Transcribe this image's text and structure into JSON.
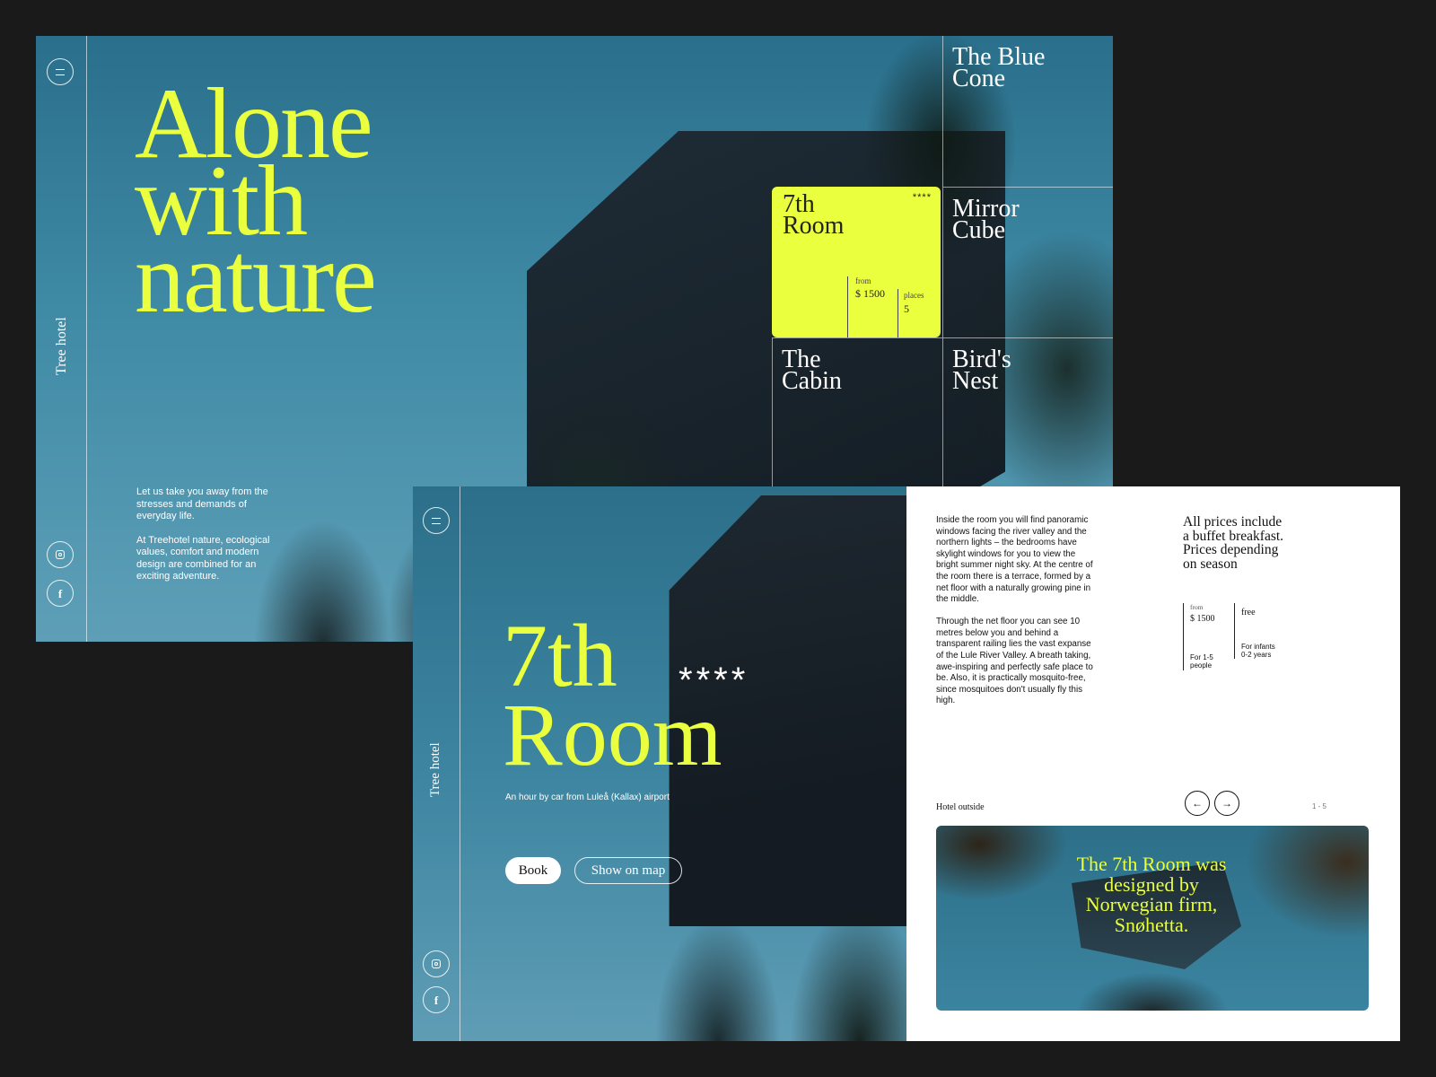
{
  "screen1": {
    "brand": "Tree hotel",
    "hero_title": "Alone\nwith\nnature",
    "intro_p1": "Let us take you away from the stresses and demands of everyday life.",
    "intro_p2": "At Treehotel nature, ecological values, comfort and modern design are combined for an exciting adventure.",
    "rooms": [
      {
        "name": "The Blue\nCone"
      },
      {
        "name": "7th\nRoom",
        "stars": "****",
        "price_label": "from",
        "price": "$ 1500",
        "places_label": "places",
        "places": "5"
      },
      {
        "name": "Mirror\nCube"
      },
      {
        "name": "The\nCabin"
      },
      {
        "name": "Bird's\nNest"
      }
    ]
  },
  "screen2": {
    "brand": "Tree hotel",
    "title": "7th\nRoom",
    "stars": "****",
    "subtitle": "An hour by car from Luleå (Kallax) airport",
    "book_label": "Book",
    "map_label": "Show on map",
    "description_p1": "Inside the room you will find panoramic windows facing the river valley and the northern lights – the bedrooms have skylight windows for you to view the bright summer night sky. At the centre of the room there is a terrace, formed by a net floor with a naturally growing pine in the middle.",
    "description_p2": "Through the net floor you can see 10 metres below you and behind a transparent railing lies the vast expanse of the Lule River Valley. A breath taking, awe-inspiring and perfectly safe place to be. Also, it is practically mosquito-free, since mosquitoes don't usually fly this high.",
    "prices_note": "All prices include\na buffet breakfast.\nPrices depending\non season",
    "price_label": "from",
    "price": "$ 1500",
    "price_note": "For 1-5\npeople",
    "free_label": "free",
    "free_note": "For infants\n0-2 years",
    "gallery_label": "Hotel outside",
    "counter": "1 - 5",
    "gallery_caption": "The 7th Room was designed by Norwegian firm, Snøhetta."
  },
  "colors": {
    "accent": "#eaff3d",
    "background": "#1a1a1a"
  },
  "icons": [
    "menu-icon",
    "instagram-icon",
    "facebook-icon",
    "arrow-left-icon",
    "arrow-right-icon"
  ]
}
